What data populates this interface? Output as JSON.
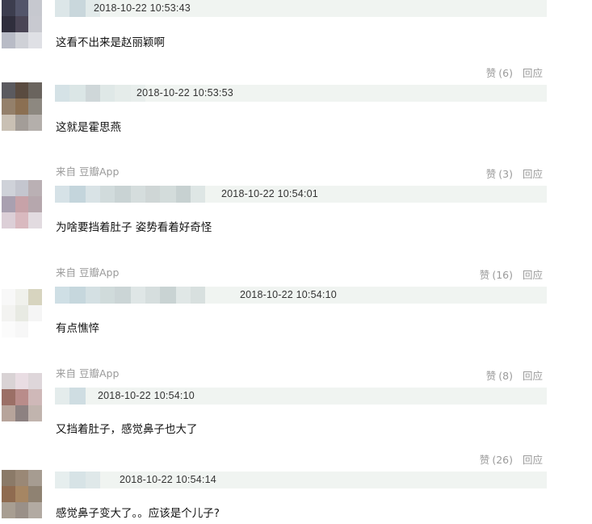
{
  "like_label": "赞",
  "reply_label": "回应",
  "comments": [
    {
      "timestamp": "2018-10-22 10:53:43",
      "text": "这看不出来是赵丽颖啊",
      "source": "",
      "likes": "(6)",
      "avatar_colors": [
        "#3c3d4e",
        "#53556a",
        "#c6c8cf",
        "#2f2e3c",
        "#4a4555",
        "#c8c9d0",
        "#b8bbc6",
        "#cfd1d7",
        "#dfe0e5"
      ],
      "author_blur_colors": [
        "#dce6e8",
        "#c9d7dc",
        "#e2eaea"
      ]
    },
    {
      "timestamp": "2018-10-22 10:53:53",
      "text": "这就是霍思燕",
      "source": "",
      "likes": "(3)",
      "avatar_colors": [
        "#5b5a5f",
        "#5a4b40",
        "#6a645e",
        "#94806b",
        "#8b6f52",
        "#8d8880",
        "#c9c0b4",
        "#a39d98",
        "#b4afab"
      ],
      "author_blur_colors": [
        "#d5e2e6",
        "#dbe6e6",
        "#cfd7d9",
        "#dfe8e7",
        "#e5ecea",
        "#e8eeec"
      ]
    },
    {
      "timestamp": "2018-10-22 10:54:01",
      "text": "为啥要挡着肚子 姿势看着好奇怪",
      "source": "来自 豆瓣App",
      "likes": "(16)",
      "avatar_colors": [
        "#cfd2d9",
        "#c4c6cf",
        "#bab0b4",
        "#a9a0b0",
        "#c7a2a8",
        "#b6a7ad",
        "#dccfd7",
        "#d9b9bf",
        "#e2dbe0"
      ],
      "author_blur_colors": [
        "#d6e2e7",
        "#c4d5dc",
        "#d9e3e6",
        "#d1dbdc",
        "#c9d3d4",
        "#d5dddd",
        "#cfd6d6",
        "#d3dcdb",
        "#c7d1d1",
        "#dee6e5"
      ]
    },
    {
      "timestamp": "2018-10-22 10:54:10",
      "text": "有点憔悴",
      "source": "来自 豆瓣App",
      "likes": "(8)",
      "avatar_colors": [
        "#f8f8f8",
        "#f0f1ec",
        "#d7d4bf",
        "#f3f3f1",
        "#e8eae3",
        "#f5f5f5",
        "#fbfbfb",
        "#f7f7f7",
        "#ffffff"
      ],
      "author_blur_colors": [
        "#cfdfe5",
        "#c6d7dd",
        "#d4e0e3",
        "#d0dbdb",
        "#cbd5d6",
        "#dfe6e6",
        "#d6dede",
        "#c9d3d3",
        "#e0e7e6",
        "#d8e0df"
      ]
    },
    {
      "timestamp": "2018-10-22 10:54:10",
      "text": "又挡着肚子，感觉鼻子也大了",
      "source": "来自 豆瓣App",
      "likes": "(26)",
      "avatar_colors": [
        "#d9d3d5",
        "#e9dde3",
        "#ded6da",
        "#9b6f66",
        "#b98c8a",
        "#cfb8b8",
        "#b7a49b",
        "#8d8181",
        "#c1b4ae"
      ],
      "author_blur_colors": [
        "#e4ecec",
        "#cfdde2"
      ]
    },
    {
      "timestamp": "2018-10-22 10:54:14",
      "text": "感觉鼻子变大了。。应该是个儿子?",
      "source": "",
      "likes": "",
      "avatar_colors": [
        "#8b7a68",
        "#9a8876",
        "#a69c91",
        "#8f6b50",
        "#a68663",
        "#8f8272",
        "#a89e92",
        "#9a9088",
        "#b2aaa2"
      ],
      "author_blur_colors": [
        "#e6eeee",
        "#d7e3e6",
        "#dfe8e9"
      ]
    }
  ]
}
